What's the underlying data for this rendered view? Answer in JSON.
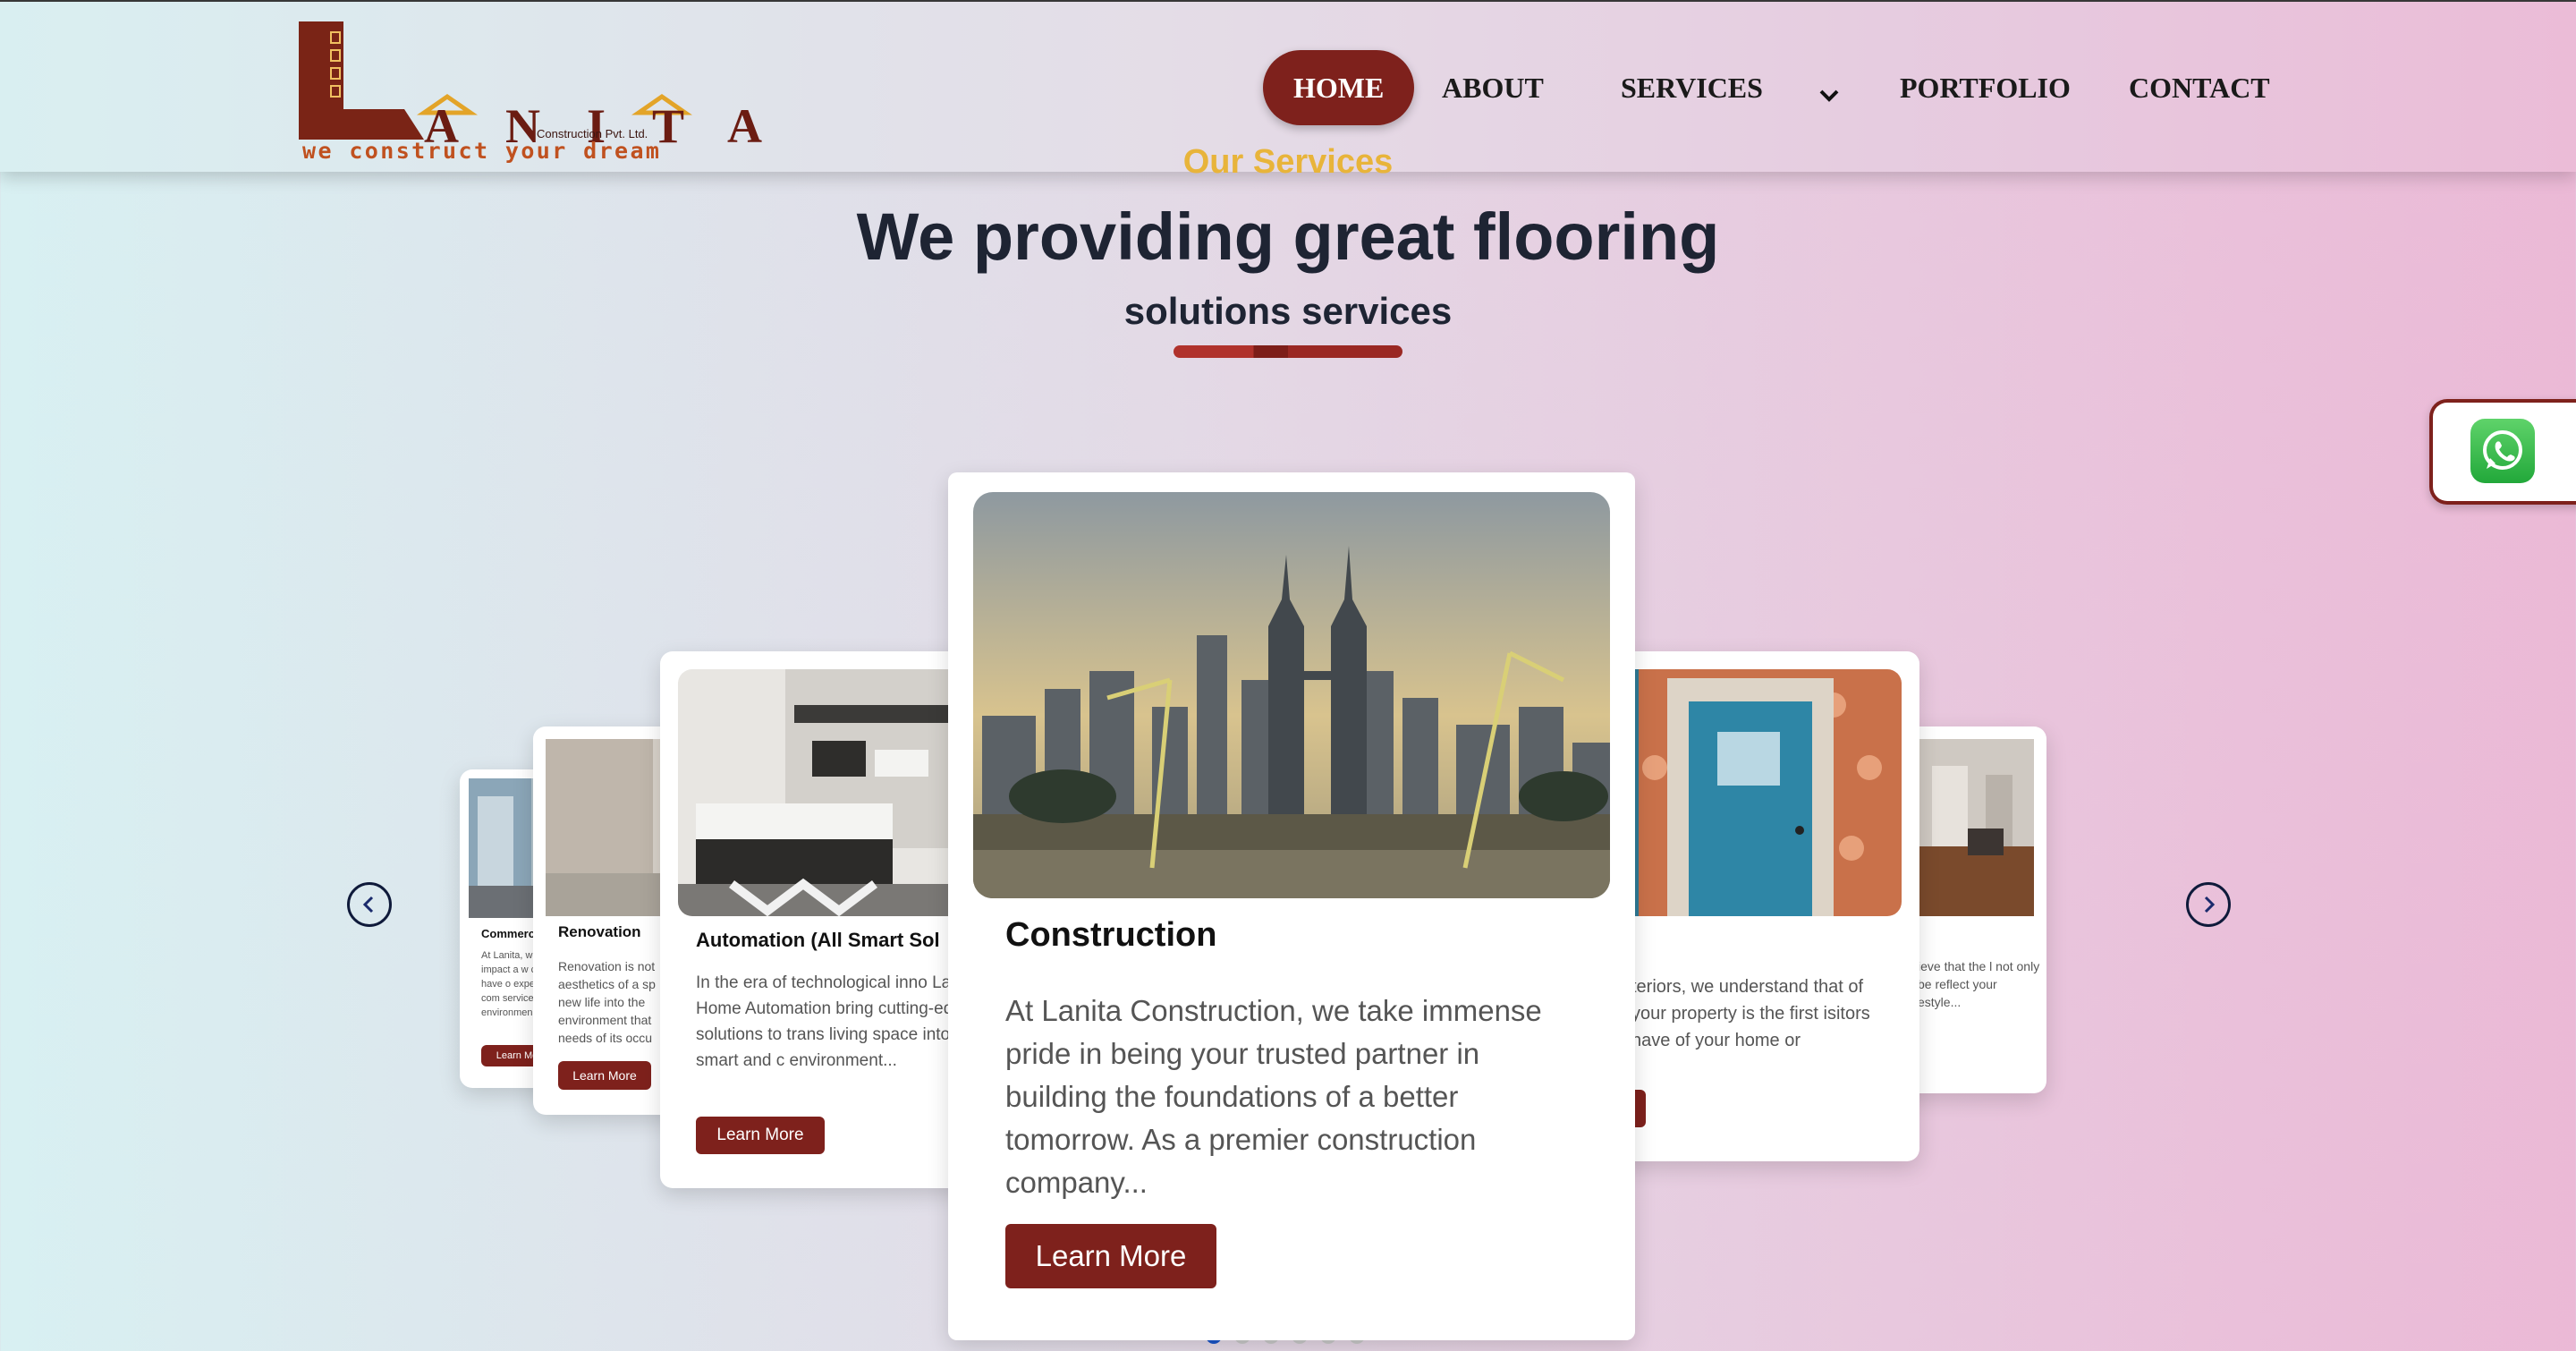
{
  "brand": {
    "letters": "ANITA",
    "subtitle": "Construction Pvt. Ltd.",
    "tagline": "we construct your dream"
  },
  "nav": {
    "items": [
      {
        "label": "HOME",
        "active": true
      },
      {
        "label": "ABOUT"
      },
      {
        "label": "SERVICES"
      },
      {
        "label": "PORTFOLIO"
      },
      {
        "label": "CONTACT"
      }
    ]
  },
  "section": {
    "eyebrow": "Our Services",
    "headline": "We providing great flooring",
    "subhead": "solutions services"
  },
  "cards": [
    {
      "title": "Commerc",
      "desc": "At Lanita, w impact a w can have o expert com services ar environmen",
      "button": "Learn Mo"
    },
    {
      "title": "Renovation",
      "desc": "Renovation is not aesthetics of a sp new life into the environment that needs of its occu",
      "button": "Learn More"
    },
    {
      "title": "Automation (All Smart Sol",
      "desc": "In the era of technological inno Lanita Home Automation bring cutting-edge solutions to trans living space into a smart and c environment...",
      "button": "Learn More"
    },
    {
      "title": "Construction",
      "desc": "At Lanita Construction, we take immense pride in being your trusted partner in building the foundations of a better tomorrow. As a premier construction company...",
      "button": "Learn More"
    },
    {
      "title": "",
      "desc": "teriors, we understand that of your property is the first isitors have of your home or",
      "button": "e"
    },
    {
      "title": "",
      "desc": "ieve that the l not only be reflect your estyle...",
      "button": ""
    }
  ],
  "carousel": {
    "total_slides": 6,
    "active_index": 0
  },
  "colors": {
    "brand_red": "#7e211c",
    "accent_gold": "#e8b43a",
    "dot_active": "#1a55c8"
  },
  "icons": {
    "prev": "chevron-left-icon",
    "next": "chevron-right-icon",
    "whatsapp": "whatsapp-icon",
    "dropdown": "chevron-down-icon"
  }
}
